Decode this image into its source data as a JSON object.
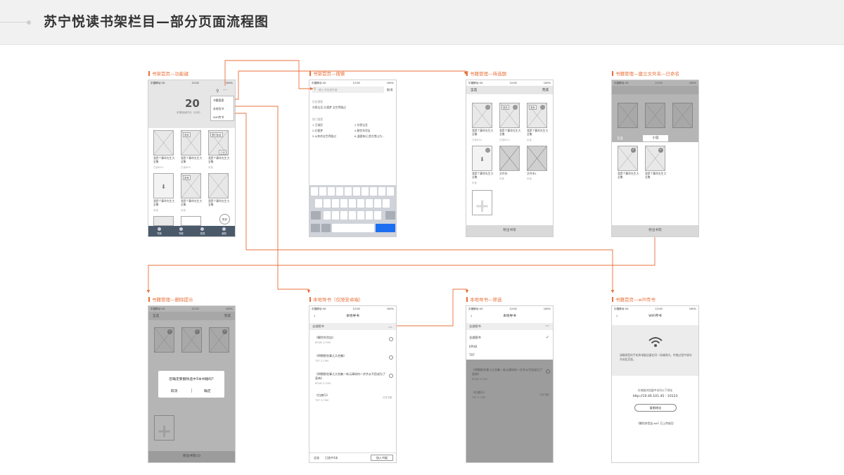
{
  "page_title": "苏宁悦读书架栏目—部分页面流程图",
  "colors": {
    "accent": "#e8703a",
    "keyboard_blue": "#1d6ff2"
  },
  "status_bar": {
    "carrier": "中国移动 4G",
    "time": "12:00",
    "battery": "100%"
  },
  "screens": {
    "home_func": {
      "label": "书架首页—功能键",
      "count": "20",
      "count_caption": "本周阅读时长（分钟）",
      "menu": [
        "书籍管理",
        "本地导书",
        "WiFi传书"
      ],
      "tags": [
        "更新",
        "限时免费",
        "已完",
        "推荐"
      ],
      "book_title": "我是个算命先生大全集",
      "book_meta": [
        "已读80%",
        "已读80%",
        "未读",
        "未读",
        "未读"
      ],
      "fab": "签到",
      "tabs": [
        "书架",
        "书城",
        "发现",
        "我的"
      ]
    },
    "search": {
      "label": "书架首页—搜索",
      "search_placeholder": "输入书名或作者",
      "cancel": "取消",
      "history_title": "历史搜索",
      "history_items": "东野圭吾  红楼梦  全世界路过",
      "hot_title": "热门搜索",
      "hot_left": [
        "1.王维民",
        "2.红楼梦",
        "5.从你的全世界路过"
      ],
      "hot_right": [
        "2.东野圭吾",
        "4.解忧杂货店",
        "6.温暖每记,是在雪山为..."
      ]
    },
    "manage_select": {
      "label": "书籍管理—待选题",
      "select_all": "全选",
      "done": "完成",
      "tags": [
        "更新",
        "更新",
        "免费"
      ],
      "book_title": "我是个算命先生大全集",
      "book_meta": [
        "已读80%",
        "已读80%",
        "未读",
        "未读",
        "未读",
        "未读"
      ],
      "folder_label": "文件夹",
      "folder_label2": "文件夹1",
      "move_out": "移出书架"
    },
    "manage_folder": {
      "label": "书籍管理—建立文件夹—已命名",
      "select_all": "全选",
      "input": "小说",
      "book_title": "我是个算命先生大全集",
      "move_out": "移出书架"
    },
    "manage_delete": {
      "label": "书籍管理—删除提示",
      "select_all": "全选",
      "done": "完成",
      "dialog_text": "您确定要删除选中3本书籍吗?",
      "cancel": "取消",
      "confirm": "确定",
      "move_out": "移出书架(3)"
    },
    "local_import": {
      "label": "本地导书（仅限安卓端）",
      "nav_title": "本地导书",
      "filter": "全部图书",
      "files": [
        {
          "name": "《解忧杂货店》",
          "meta": "EPUB  3.75M",
          "status": ""
        },
        {
          "name": "《明朝那些事儿大合集》",
          "meta": "TXT  3.75M",
          "status": ""
        },
        {
          "name": "《明朝那些事儿大合集—朱元璋如何一步步从平民成为了皇帝》",
          "meta": "EPUB  3.75M",
          "status": ""
        },
        {
          "name": "《白夜行》",
          "meta": "TXT  3.75M",
          "status": "已在书架"
        }
      ],
      "select_all": "全选",
      "selected": "已选中3本",
      "add_button": "加入书架"
    },
    "local_filter": {
      "label": "本地导书—筛选",
      "nav_title": "本地导书",
      "filter": "全部图书",
      "options": [
        "全部图书",
        "EPUB",
        "TXT"
      ],
      "files": [
        {
          "name": "《明朝那些事儿大合集—朱元璋如何一步步从平民成为了皇帝》",
          "meta": "EPUB  3.75M",
          "status": ""
        },
        {
          "name": "《白夜行》",
          "meta": "TXT  3.75M",
          "status": "已在书架"
        }
      ]
    },
    "wifi": {
      "label": "书籍首页—wifi传书",
      "nav_title": "WiFi传书",
      "tip": "请确保您的手机和电脑设备在同一局域网内，传输过程中请勿关闭此页面。",
      "address_caption": "在电脑浏览器中访问以下地址",
      "address": "http://10.46.101.45 : 10123",
      "copy_button": "复制地址",
      "success_text": "《解忧杂货店.txt》已上传成功"
    }
  }
}
